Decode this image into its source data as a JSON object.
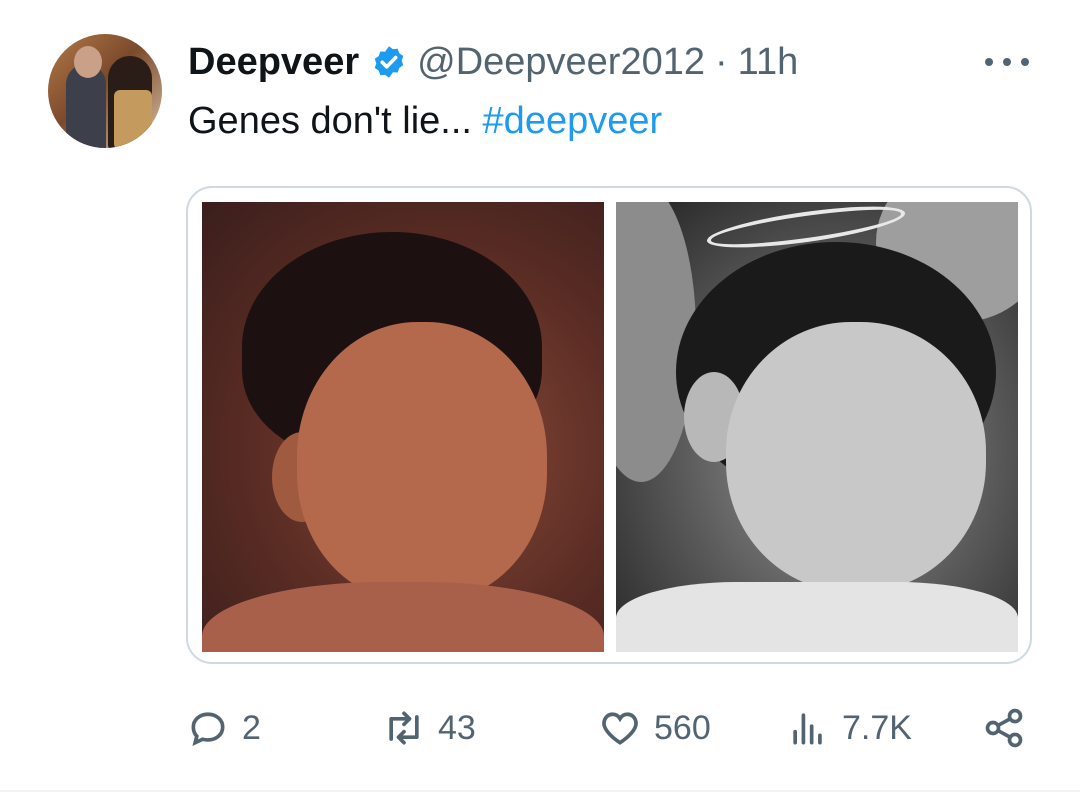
{
  "tweet": {
    "display_name": "Deepveer",
    "handle": "@Deepveer2012",
    "separator": "·",
    "time": "11h",
    "text_prefix": "Genes don't lie... ",
    "hashtag": "#deepveer",
    "verified": true
  },
  "media": {
    "photos": [
      {
        "description_icon": "photo-icon"
      },
      {
        "description_icon": "photo-icon"
      }
    ]
  },
  "actions": {
    "reply_count": "2",
    "retweet_count": "43",
    "like_count": "560",
    "views_count": "7.7K"
  },
  "colors": {
    "accent": "#1d9bf0",
    "secondary_text": "#536471",
    "primary_text": "#0f1419",
    "border": "#cfd9de"
  },
  "icons": [
    "verified-badge-icon",
    "more-icon",
    "reply-icon",
    "retweet-icon",
    "like-icon",
    "views-icon",
    "share-icon"
  ]
}
